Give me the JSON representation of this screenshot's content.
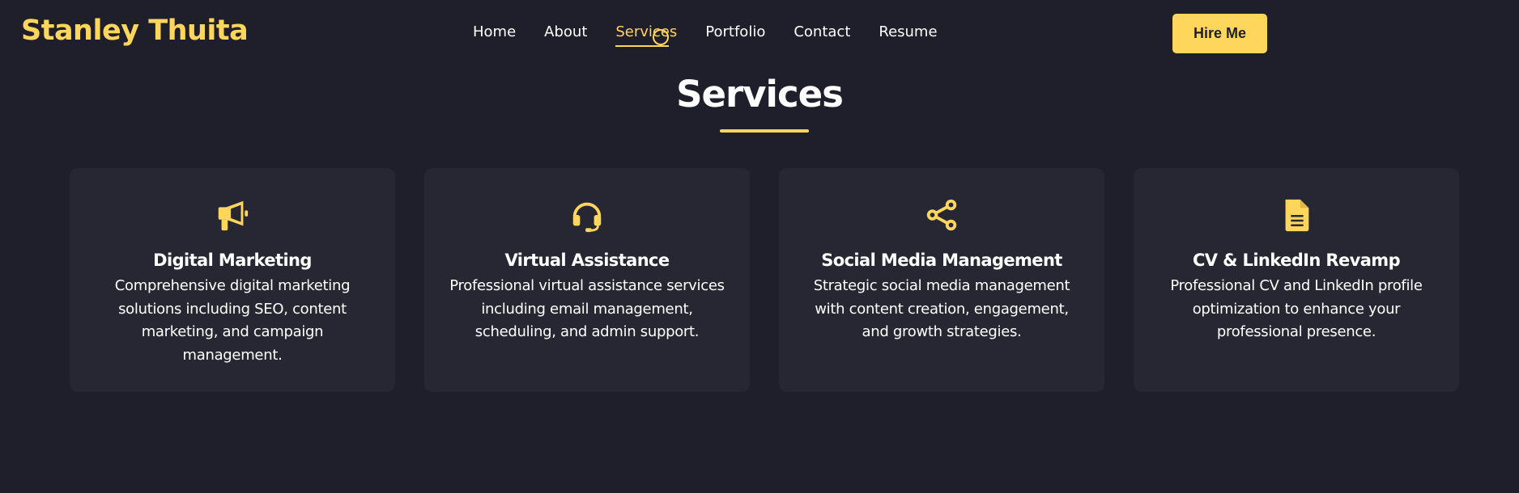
{
  "brand": {
    "name": "Stanley Thuita"
  },
  "nav": {
    "items": [
      {
        "label": "Home"
      },
      {
        "label": "About"
      },
      {
        "label": "Services"
      },
      {
        "label": "Portfolio"
      },
      {
        "label": "Contact"
      },
      {
        "label": "Resume"
      }
    ],
    "active": "Services"
  },
  "header": {
    "hire_label": "Hire Me"
  },
  "section": {
    "title": "Services"
  },
  "services": [
    {
      "icon": "megaphone-icon",
      "title": "Digital Marketing",
      "description": "Comprehensive digital marketing solutions including SEO, content marketing, and campaign management."
    },
    {
      "icon": "headset-icon",
      "title": "Virtual Assistance",
      "description": "Professional virtual assistance services including email management, scheduling, and admin support."
    },
    {
      "icon": "share-icon",
      "title": "Social Media Management",
      "description": "Strategic social media management with content creation, engagement, and growth strategies."
    },
    {
      "icon": "document-icon",
      "title": "CV & LinkedIn Revamp",
      "description": "Professional CV and LinkedIn profile optimization to enhance your professional presence."
    }
  ],
  "colors": {
    "accent": "#ffd65c",
    "background": "#1f1f2c",
    "card": "#272733"
  }
}
